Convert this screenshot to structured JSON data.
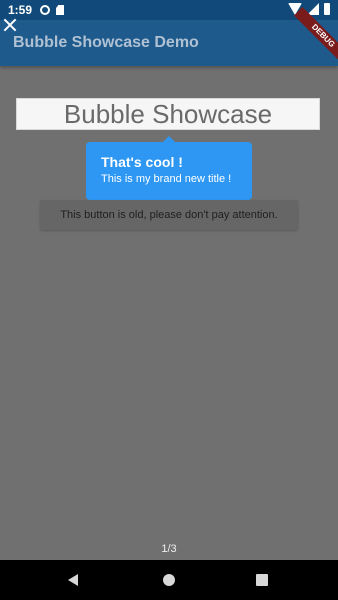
{
  "status_bar": {
    "time": "1:59",
    "icons": [
      "gear-icon",
      "sd-card-icon",
      "wifi-icon",
      "signal-icon",
      "battery-icon"
    ]
  },
  "app_bar": {
    "title": "Bubble Showcase Demo",
    "debug_banner": "DEBUG"
  },
  "main": {
    "showcase_title": "Bubble Showcase",
    "bubble": {
      "title": "That's cool !",
      "subtitle": "This is my brand new title !"
    },
    "old_button_label": "This button is old, please don't pay attention.",
    "page_counter": "1/3"
  },
  "colors": {
    "overlay": "#707070",
    "bubble": "#2d97f3",
    "app_bar": "#1e5a8c"
  },
  "nav_bar": {
    "icons": [
      "back-icon",
      "home-icon",
      "recent-apps-icon"
    ]
  }
}
